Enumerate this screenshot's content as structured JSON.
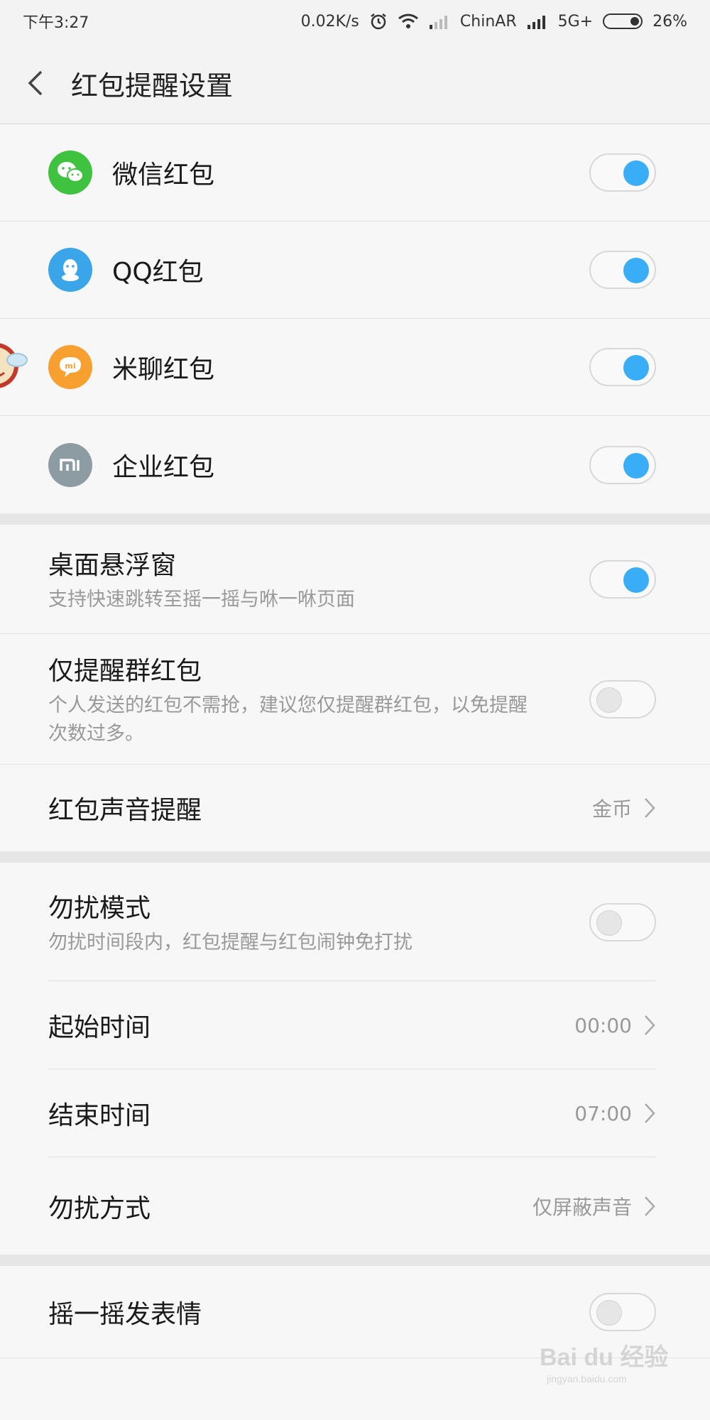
{
  "status_bar": {
    "time": "下午3:27",
    "speed": "0.02K/s",
    "carrier": "ChinAR",
    "network": "5G+",
    "battery": "26%"
  },
  "header": {
    "title": "红包提醒设置"
  },
  "apps": [
    {
      "label": "微信红包",
      "icon": "wechat-icon",
      "color": "#3fc23f",
      "on": true
    },
    {
      "label": "QQ红包",
      "icon": "qq-icon",
      "color": "#3aa6e9",
      "on": true
    },
    {
      "label": "米聊红包",
      "icon": "miliao-icon",
      "color": "#f7a030",
      "on": true
    },
    {
      "label": "企业红包",
      "icon": "mi-icon",
      "color": "#8d9ba3",
      "on": true
    }
  ],
  "settings": {
    "floating_window": {
      "label": "桌面悬浮窗",
      "desc": "支持快速跳转至摇一摇与咻一咻页面",
      "on": true
    },
    "group_only": {
      "label": "仅提醒群红包",
      "desc": "个人发送的红包不需抢，建议您仅提醒群红包，以免提醒次数过多。",
      "on": false
    },
    "sound": {
      "label": "红包声音提醒",
      "value": "金币"
    }
  },
  "dnd": {
    "mode": {
      "label": "勿扰模式",
      "desc": "勿扰时间段内，红包提醒与红包闹钟免打扰",
      "on": false
    },
    "start": {
      "label": "起始时间",
      "value": "00:00"
    },
    "end": {
      "label": "结束时间",
      "value": "07:00"
    },
    "method": {
      "label": "勿扰方式",
      "value": "仅屏蔽声音"
    }
  },
  "shake": {
    "label": "摇一摇发表情",
    "on": false
  },
  "watermark": {
    "text": "Bai du 经验",
    "sub": "jingyan.baidu.com"
  },
  "colors": {
    "accent": "#3aadf7",
    "toggle_off": "#e6e6e6"
  }
}
